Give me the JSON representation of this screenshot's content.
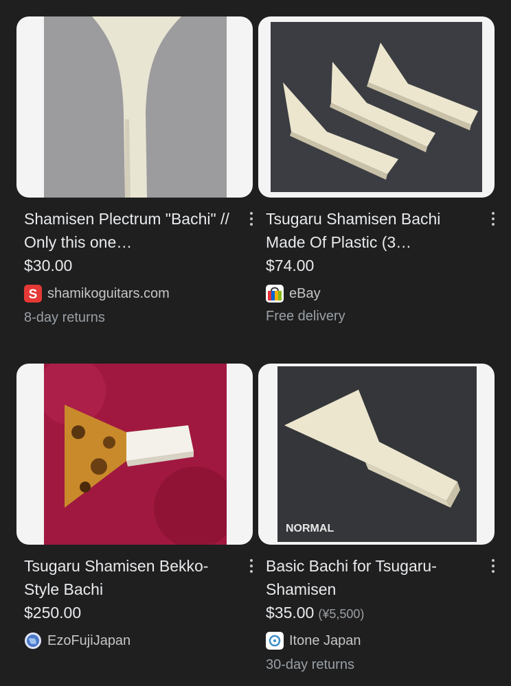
{
  "products": [
    {
      "title": "Shamisen Plectrum \"Bachi\" // Only this one…",
      "price": "$30.00",
      "store": "shamikoguitars.com",
      "store_icon": "shamiko-s-logo-icon",
      "extra": "8-day returns"
    },
    {
      "title": "Tsugaru Shamisen Bachi Made Of Plastic (3…",
      "price": "$74.00",
      "store": "eBay",
      "store_icon": "ebay-bag-icon",
      "extra": "Free delivery"
    },
    {
      "title": "Tsugaru Shamisen Bekko-Style Bachi",
      "price": "$250.00",
      "store": "EzoFujiJapan",
      "store_icon": "globe-icon",
      "extra": ""
    },
    {
      "title": "Basic Bachi for Tsugaru-Shamisen",
      "price": "$35.00",
      "price_secondary": "(¥5,500)",
      "store": "Itone Japan",
      "store_icon": "itone-logo-icon",
      "extra": "30-day returns",
      "image_caption": "NORMAL"
    }
  ],
  "colors": {
    "background": "#1f1f1f",
    "text_primary": "#e8eaed",
    "text_secondary": "#9aa0a6"
  }
}
